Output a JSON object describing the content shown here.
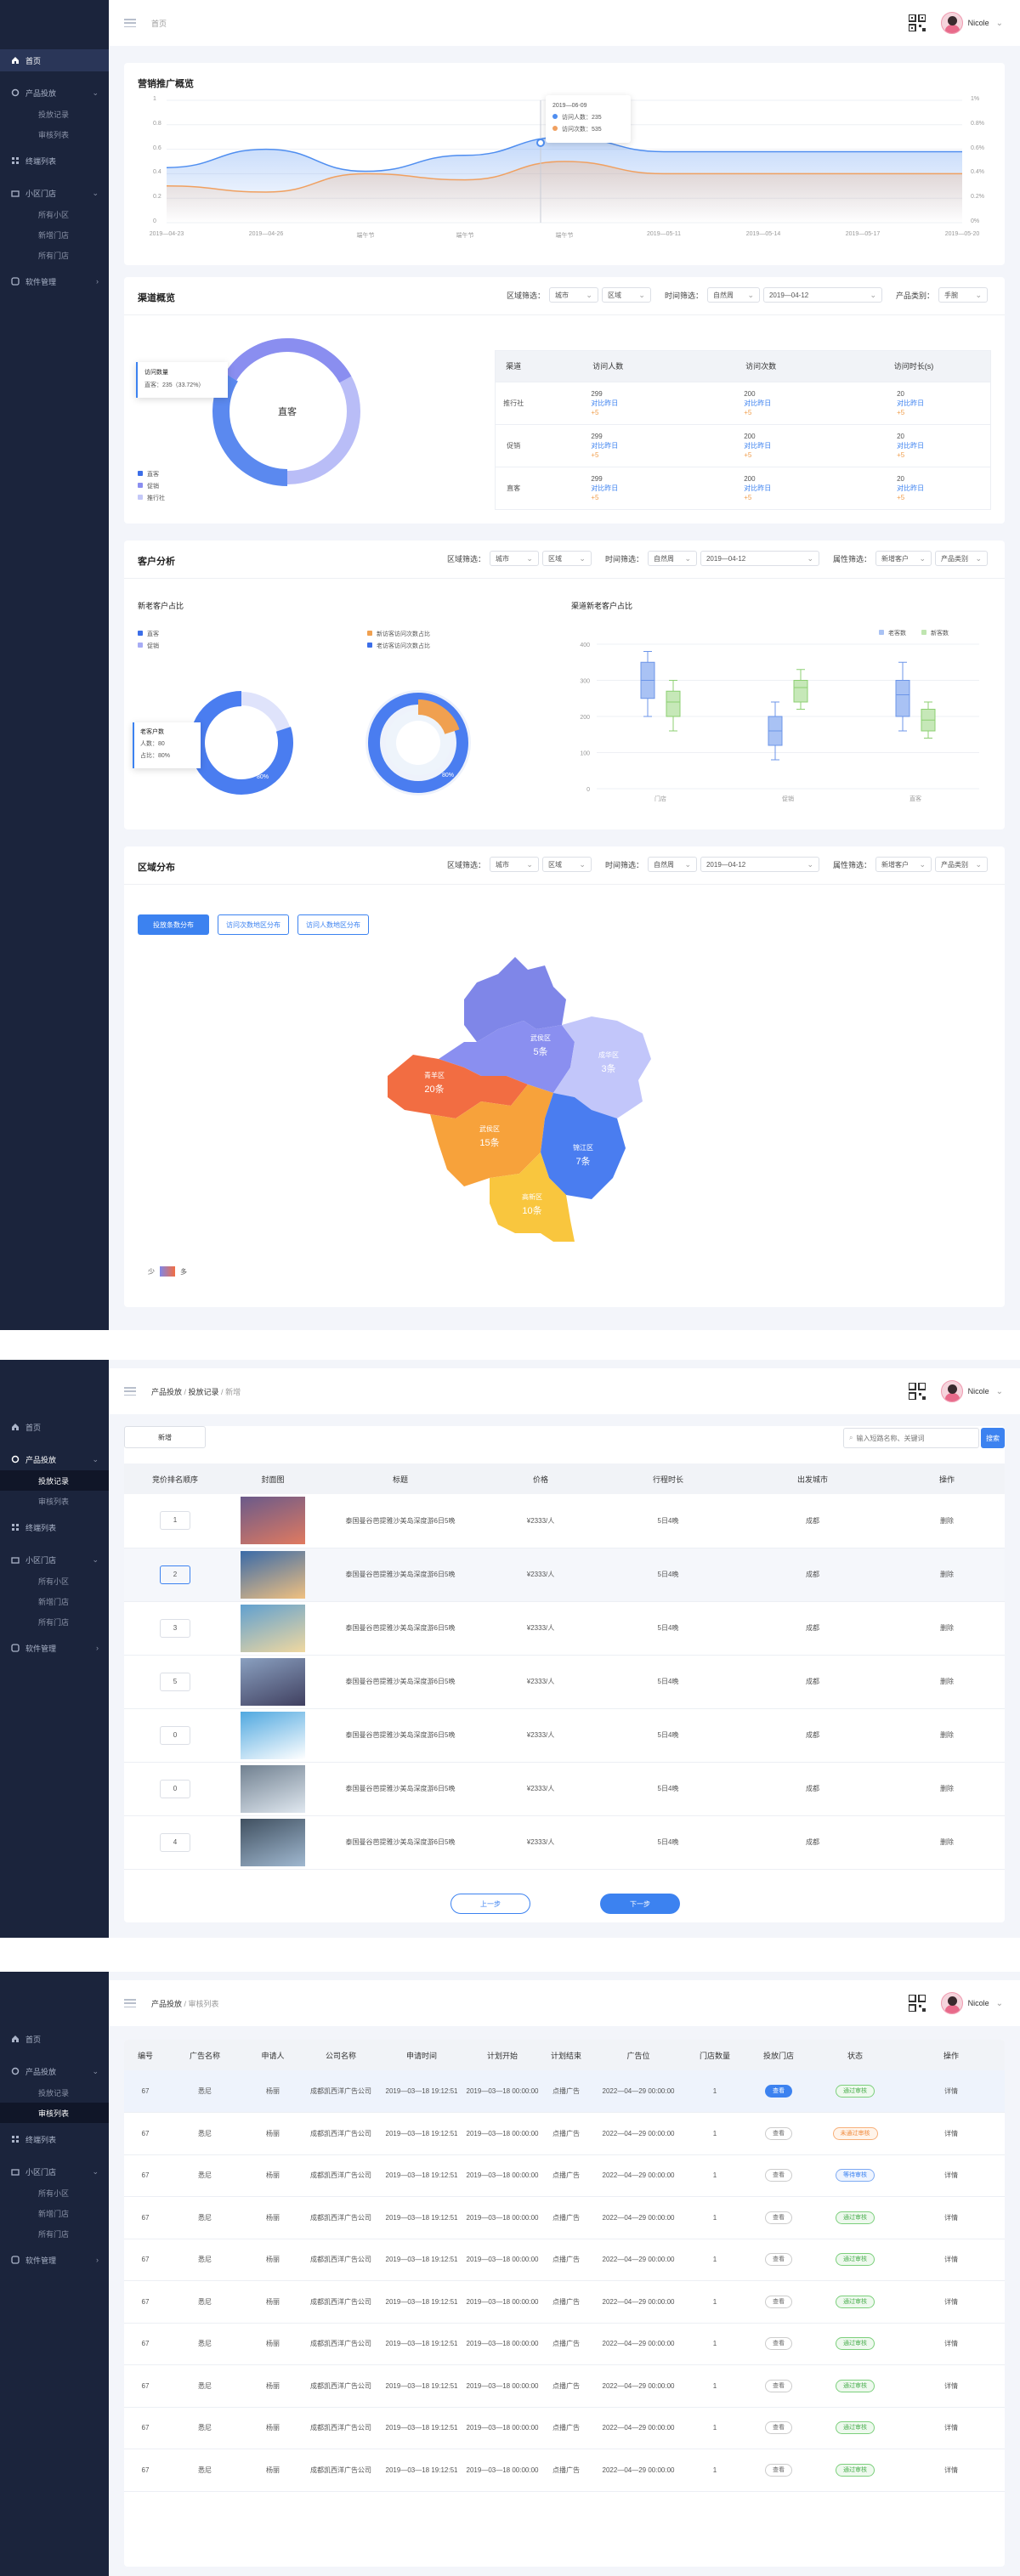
{
  "user": {
    "name": "Nicole"
  },
  "sidebar1": {
    "items": [
      {
        "label": "首页",
        "icon": "home-icon",
        "active": true
      },
      {
        "label": "产品投放",
        "icon": "gear-icon",
        "expand": true
      },
      {
        "label": "投放记录",
        "sub": true
      },
      {
        "label": "审核列表",
        "sub": true
      },
      {
        "label": "终端列表",
        "icon": "grid-icon"
      },
      {
        "label": "小区门店",
        "icon": "store-icon",
        "expand": true
      },
      {
        "label": "所有小区",
        "sub": true
      },
      {
        "label": "新增门店",
        "sub": true
      },
      {
        "label": "所有门店",
        "sub": true
      },
      {
        "label": "软件管理",
        "icon": "app-icon",
        "arrow": true
      }
    ]
  },
  "screen1": {
    "breadcrumb": "首页",
    "overview": {
      "title": "营销推广概览",
      "yleft": [
        "1",
        "0.8",
        "0.6",
        "0.4",
        "0.2",
        "0"
      ],
      "yright": [
        "1%",
        "0.8%",
        "0.6%",
        "0.4%",
        "0.2%",
        "0%"
      ],
      "xticks": [
        "2019—04-23",
        "2019—04-26",
        "端午节",
        "端午节",
        "端午节",
        "2019—05-11",
        "2019—05-14",
        "2019—05-17",
        "2019—05-20"
      ],
      "tooltip": {
        "date": "2019—06-09",
        "visitors": "访问人数：235",
        "visits": "访问次数：535"
      }
    },
    "channel": {
      "title": "渠道概览",
      "filters": {
        "region_label": "区域筛选：",
        "city": "城市",
        "district": "区域",
        "time_label": "时间筛选：",
        "period": "自然周",
        "date": "2019—04-12",
        "product_label": "产品类别：",
        "product": "手腕"
      },
      "donut_center": "直客",
      "tooltip": {
        "title": "访问数量",
        "line": "直客：235（33.72%）"
      },
      "legend": [
        "直客",
        "促销",
        "推行社"
      ],
      "table": {
        "headers": [
          "渠道",
          "访问人数",
          "访问次数",
          "访问时长(s)"
        ],
        "rows": [
          {
            "name": "推行社",
            "c1": "299",
            "c2": "200",
            "c3": "20",
            "link": "对比昨日",
            "pct": "+5"
          },
          {
            "name": "促销",
            "c1": "299",
            "c2": "200",
            "c3": "20",
            "link": "对比昨日",
            "pct": "+5"
          },
          {
            "name": "直客",
            "c1": "299",
            "c2": "200",
            "c3": "20",
            "link": "对比昨日",
            "pct": "+5"
          }
        ]
      }
    },
    "customer": {
      "title": "客户分析",
      "filters": {
        "region_label": "区域筛选：",
        "city": "城市",
        "district": "区域",
        "time_label": "时间筛选：",
        "period": "自然周",
        "date": "2019—04-12",
        "attr_label": "属性筛选：",
        "attr": "新增客户",
        "product": "产品类别"
      },
      "sub1": "新老客户占比",
      "legend1": [
        "直客",
        "促销"
      ],
      "legend2": [
        "新访客访问次数占比",
        "老访客访问次数占比"
      ],
      "tooltip": {
        "title": "老客户数",
        "count": "人数：80",
        "pct": "占比：80%"
      },
      "pct_label1": "80%",
      "pct_label2": "80%",
      "pct_label3": "20%",
      "sub2": "渠道新老客户占比",
      "box_legend": [
        "老客数",
        "新客数"
      ],
      "box_y": [
        "400",
        "300",
        "200",
        "100",
        "0"
      ],
      "box_x": [
        "门店",
        "促销",
        "直客"
      ]
    },
    "region": {
      "title": "区域分布",
      "filters": {
        "region_label": "区域筛选：",
        "city": "城市",
        "district": "区域",
        "time_label": "时间筛选：",
        "period": "自然周",
        "date": "2019—04-12",
        "attr_label": "属性筛选：",
        "attr": "新增客户",
        "product": "产品类别"
      },
      "tabs": [
        "投放条数分布",
        "访问次数地区分布",
        "访问人数地区分布"
      ],
      "districts": [
        {
          "name": "武侯区",
          "count": "5条"
        },
        {
          "name": "成华区",
          "count": "3条"
        },
        {
          "name": "青羊区",
          "count": "20条"
        },
        {
          "name": "武侯区",
          "count": "15条"
        },
        {
          "name": "锦江区",
          "count": "7条"
        },
        {
          "name": "高新区",
          "count": "10条"
        }
      ],
      "scale": {
        "low": "少",
        "high": "多"
      }
    }
  },
  "screen2": {
    "breadcrumb": [
      "产品投放",
      "投放记录",
      "新增"
    ],
    "add_label": "新增",
    "search_placeholder": "输入短路名称、关键词",
    "search_btn": "搜索",
    "headers": [
      "竞价排名顺序",
      "封面图",
      "标题",
      "价格",
      "行程时长",
      "出发城市",
      "操作"
    ],
    "rows": [
      {
        "rank": "1",
        "title": "泰国曼谷芭提雅沙美岛深度游6日5晚",
        "price": "¥2333/人",
        "duration": "5日4晚",
        "city": "成都",
        "op": "删除"
      },
      {
        "rank": "2",
        "title": "泰国曼谷芭提雅沙美岛深度游6日5晚",
        "price": "¥2333/人",
        "duration": "5日4晚",
        "city": "成都",
        "op": "删除"
      },
      {
        "rank": "3",
        "title": "泰国曼谷芭提雅沙美岛深度游6日5晚",
        "price": "¥2333/人",
        "duration": "5日4晚",
        "city": "成都",
        "op": "删除"
      },
      {
        "rank": "5",
        "title": "泰国曼谷芭提雅沙美岛深度游6日5晚",
        "price": "¥2333/人",
        "duration": "5日4晚",
        "city": "成都",
        "op": "删除"
      },
      {
        "rank": "0",
        "title": "泰国曼谷芭提雅沙美岛深度游6日5晚",
        "price": "¥2333/人",
        "duration": "5日4晚",
        "city": "成都",
        "op": "删除"
      },
      {
        "rank": "0",
        "title": "泰国曼谷芭提雅沙美岛深度游6日5晚",
        "price": "¥2333/人",
        "duration": "5日4晚",
        "city": "成都",
        "op": "删除"
      },
      {
        "rank": "4",
        "title": "泰国曼谷芭提雅沙美岛深度游6日5晚",
        "price": "¥2333/人",
        "duration": "5日4晚",
        "city": "成都",
        "op": "删除"
      }
    ],
    "prev": "上一步",
    "next": "下一步"
  },
  "screen3": {
    "breadcrumb": [
      "产品投放",
      "审核列表"
    ],
    "headers": [
      "编号",
      "广告名称",
      "申请人",
      "公司名称",
      "申请时间",
      "计划开始",
      "计划结束",
      "广告位",
      "门店数量",
      "投放门店",
      "状态",
      "操作"
    ],
    "rows": [
      {
        "id": "67",
        "name": "悉尼",
        "applicant": "杨丽",
        "company": "成都凯西洋广告公司",
        "apply": "2019—03—18 19:12:51",
        "start": "2019—03—18 00:00:00",
        "end": "点播广告",
        "slot": "2022—04—29 00:00:00",
        "stores": "1",
        "view": "查看",
        "status": "通过审核",
        "status_type": "green",
        "op": "详情"
      },
      {
        "id": "67",
        "name": "悉尼",
        "applicant": "杨丽",
        "company": "成都凯西洋广告公司",
        "apply": "2019—03—18 19:12:51",
        "start": "2019—03—18 00:00:00",
        "end": "点播广告",
        "slot": "2022—04—29 00:00:00",
        "stores": "1",
        "view": "查看",
        "status": "未通过审核",
        "status_type": "orange",
        "op": "详情"
      },
      {
        "id": "67",
        "name": "悉尼",
        "applicant": "杨丽",
        "company": "成都凯西洋广告公司",
        "apply": "2019—03—18 19:12:51",
        "start": "2019—03—18 00:00:00",
        "end": "点播广告",
        "slot": "2022—04—29 00:00:00",
        "stores": "1",
        "view": "查看",
        "status": "等待审核",
        "status_type": "blue",
        "op": "详情"
      },
      {
        "id": "67",
        "name": "悉尼",
        "applicant": "杨丽",
        "company": "成都凯西洋广告公司",
        "apply": "2019—03—18 19:12:51",
        "start": "2019—03—18 00:00:00",
        "end": "点播广告",
        "slot": "2022—04—29 00:00:00",
        "stores": "1",
        "view": "查看",
        "status": "通过审核",
        "status_type": "green",
        "op": "详情"
      },
      {
        "id": "67",
        "name": "悉尼",
        "applicant": "杨丽",
        "company": "成都凯西洋广告公司",
        "apply": "2019—03—18 19:12:51",
        "start": "2019—03—18 00:00:00",
        "end": "点播广告",
        "slot": "2022—04—29 00:00:00",
        "stores": "1",
        "view": "查看",
        "status": "通过审核",
        "status_type": "green",
        "op": "详情"
      },
      {
        "id": "67",
        "name": "悉尼",
        "applicant": "杨丽",
        "company": "成都凯西洋广告公司",
        "apply": "2019—03—18 19:12:51",
        "start": "2019—03—18 00:00:00",
        "end": "点播广告",
        "slot": "2022—04—29 00:00:00",
        "stores": "1",
        "view": "查看",
        "status": "通过审核",
        "status_type": "green",
        "op": "详情"
      },
      {
        "id": "67",
        "name": "悉尼",
        "applicant": "杨丽",
        "company": "成都凯西洋广告公司",
        "apply": "2019—03—18 19:12:51",
        "start": "2019—03—18 00:00:00",
        "end": "点播广告",
        "slot": "2022—04—29 00:00:00",
        "stores": "1",
        "view": "查看",
        "status": "通过审核",
        "status_type": "green",
        "op": "详情"
      },
      {
        "id": "67",
        "name": "悉尼",
        "applicant": "杨丽",
        "company": "成都凯西洋广告公司",
        "apply": "2019—03—18 19:12:51",
        "start": "2019—03—18 00:00:00",
        "end": "点播广告",
        "slot": "2022—04—29 00:00:00",
        "stores": "1",
        "view": "查看",
        "status": "通过审核",
        "status_type": "green",
        "op": "详情"
      },
      {
        "id": "67",
        "name": "悉尼",
        "applicant": "杨丽",
        "company": "成都凯西洋广告公司",
        "apply": "2019—03—18 19:12:51",
        "start": "2019—03—18 00:00:00",
        "end": "点播广告",
        "slot": "2022—04—29 00:00:00",
        "stores": "1",
        "view": "查看",
        "status": "通过审核",
        "status_type": "green",
        "op": "详情"
      },
      {
        "id": "67",
        "name": "悉尼",
        "applicant": "杨丽",
        "company": "成都凯西洋广告公司",
        "apply": "2019—03—18 19:12:51",
        "start": "2019—03—18 00:00:00",
        "end": "点播广告",
        "slot": "2022—04—29 00:00:00",
        "stores": "1",
        "view": "查看",
        "status": "通过审核",
        "status_type": "green",
        "op": "详情"
      }
    ]
  },
  "colors": {
    "accent": "#3c82f0",
    "sidebar": "#1b243c",
    "orange": "#f0a050",
    "purple": "#8a8ef0"
  },
  "chart_data": [
    {
      "type": "line",
      "title": "营销推广概览",
      "x": [
        "2019—04-23",
        "2019—04-26",
        "端午节",
        "端午节",
        "端午节",
        "2019—05-11",
        "2019—05-14",
        "2019—05-17",
        "2019—05-20"
      ],
      "ylim": [
        0,
        1
      ],
      "series": [
        {
          "name": "访问人数",
          "values": [
            0.45,
            0.6,
            0.42,
            0.55,
            0.7,
            0.58,
            0.58,
            0.58,
            0.58
          ]
        },
        {
          "name": "访问次数",
          "values": [
            0.3,
            0.25,
            0.4,
            0.35,
            0.5,
            0.4,
            0.4,
            0.4,
            0.4
          ]
        }
      ]
    },
    {
      "type": "pie",
      "title": "渠道概览",
      "categories": [
        "直客",
        "促销",
        "推行社"
      ],
      "values": [
        33.72,
        33.28,
        33.0
      ]
    },
    {
      "type": "pie",
      "title": "新老客户占比",
      "categories": [
        "直客",
        "促销"
      ],
      "values": [
        80,
        20
      ]
    },
    {
      "type": "pie",
      "title": "新老客户占比",
      "categories": [
        "老访客访问次数占比",
        "新访客访问次数占比"
      ],
      "values": [
        80,
        20
      ]
    },
    {
      "type": "bar",
      "title": "渠道新老客户占比",
      "categories": [
        "门店",
        "促销",
        "直客"
      ],
      "ylim": [
        0,
        400
      ],
      "series": [
        {
          "name": "老客数",
          "box": [
            [
              200,
              250,
              300,
              350,
              380
            ],
            [
              80,
              120,
              160,
              200,
              240
            ],
            [
              160,
              200,
              260,
              300,
              350
            ]
          ]
        },
        {
          "name": "新客数",
          "box": [
            [
              160,
              200,
              240,
              270,
              300
            ],
            [
              220,
              240,
              280,
              300,
              330
            ],
            [
              140,
              160,
              190,
              220,
              240
            ]
          ]
        }
      ]
    }
  ]
}
